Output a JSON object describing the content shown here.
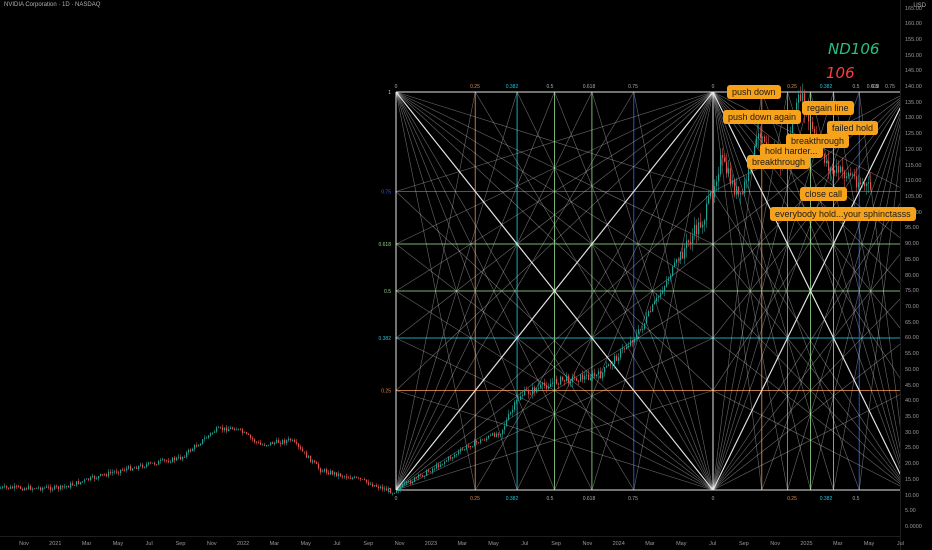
{
  "header": {
    "title": "NVIDIA Corporation · 1D · NASDAQ",
    "currency": "USD"
  },
  "price_axis": {
    "ticks": [
      "165.00",
      "160.00",
      "155.00",
      "150.00",
      "145.00",
      "140.00",
      "135.00",
      "130.00",
      "125.00",
      "120.00",
      "115.00",
      "110.00",
      "105.00",
      "100.00",
      "95.00",
      "90.00",
      "85.00",
      "80.00",
      "75.00",
      "70.00",
      "65.00",
      "60.00",
      "55.00",
      "50.00",
      "45.00",
      "40.00",
      "35.00",
      "30.00",
      "25.00",
      "20.00",
      "15.00",
      "10.00",
      "5.00",
      "0.0000"
    ]
  },
  "time_axis": {
    "ticks": [
      "Nov",
      "2021",
      "Mar",
      "May",
      "Jul",
      "Sep",
      "Nov",
      "2022",
      "Mar",
      "May",
      "Jul",
      "Sep",
      "Nov",
      "2023",
      "Mar",
      "May",
      "Jul",
      "Sep",
      "Nov",
      "2024",
      "Mar",
      "May",
      "Jul",
      "Sep",
      "Nov",
      "2025",
      "Mar",
      "May",
      "Jul"
    ]
  },
  "gann_labels": {
    "top": [
      "0",
      "0.25",
      "0.382",
      "0.5",
      "0.618",
      "0.75",
      "0",
      "0.25",
      "0.382",
      "0.5",
      "0.618",
      "0.75",
      "0.5",
      "0.6"
    ],
    "left": [
      "1",
      "0.75",
      "0.618",
      "0.5",
      "0.382",
      "0.25",
      "0"
    ],
    "bottom": [
      "0",
      "0.25",
      "0.382",
      "0.5",
      "0.618",
      "0.75",
      "0",
      "0.25",
      "0.382",
      "0.5",
      "0.6"
    ]
  },
  "annotations": [
    "push down",
    "push down again",
    "regain line",
    "failed hold",
    "breakthrough",
    "hold harder...",
    "breakthrough",
    "close call",
    "everybody hold...your sphinctasss"
  ],
  "handwritten": [
    "ND106",
    "106"
  ],
  "colors": {
    "orange": "#f7a21b",
    "gann_orange": "#e0894a",
    "gann_blue": "#2a62ff",
    "gann_cyan": "#22c3d8",
    "gann_green": "#8fd18a",
    "gann_white": "#e8e8e8",
    "green_note": "#26c281",
    "red_note": "#ff3b3b"
  }
}
